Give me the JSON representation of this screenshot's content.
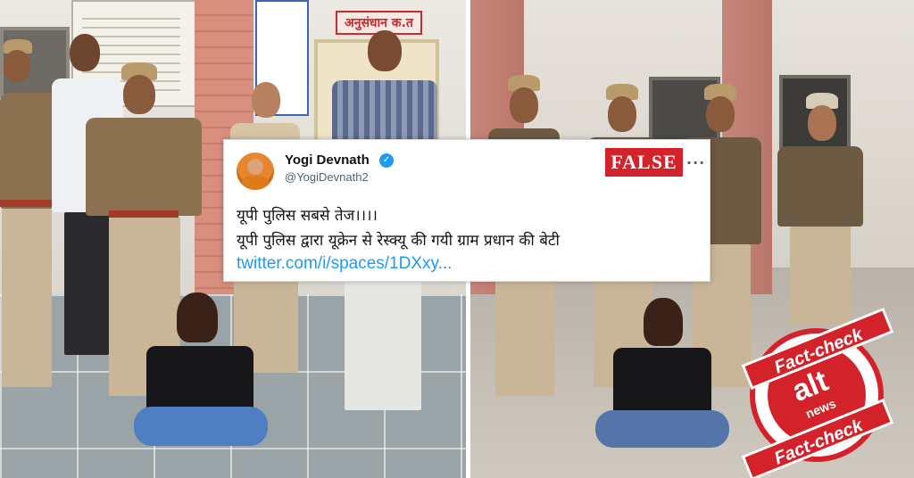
{
  "tweet": {
    "display_name": "Yogi Devnath",
    "handle": "@YogiDevnath2",
    "line1": "यूपी पुलिस सबसे तेज।।।।",
    "line2": "यूपी पुलिस द्वारा यूक्रेन से रेस्क्यू की गयी ग्राम प्रधान की बेटी",
    "link": "twitter.com/i/spaces/1DXxy...",
    "verified_icon": "verified-badge-icon",
    "more_label": "···"
  },
  "rating_badge": {
    "label": "FALSE",
    "color": "#d4222a"
  },
  "left_photo": {
    "sign_text": "अनुसंधान क.त"
  },
  "stamp": {
    "top_label": "Fact-check",
    "bottom_label": "Fact-check",
    "brand": "alt",
    "brand_sub": "news",
    "color": "#d4222a"
  },
  "colors": {
    "link": "#1d9bf0",
    "verified": "#1d9bf0"
  }
}
